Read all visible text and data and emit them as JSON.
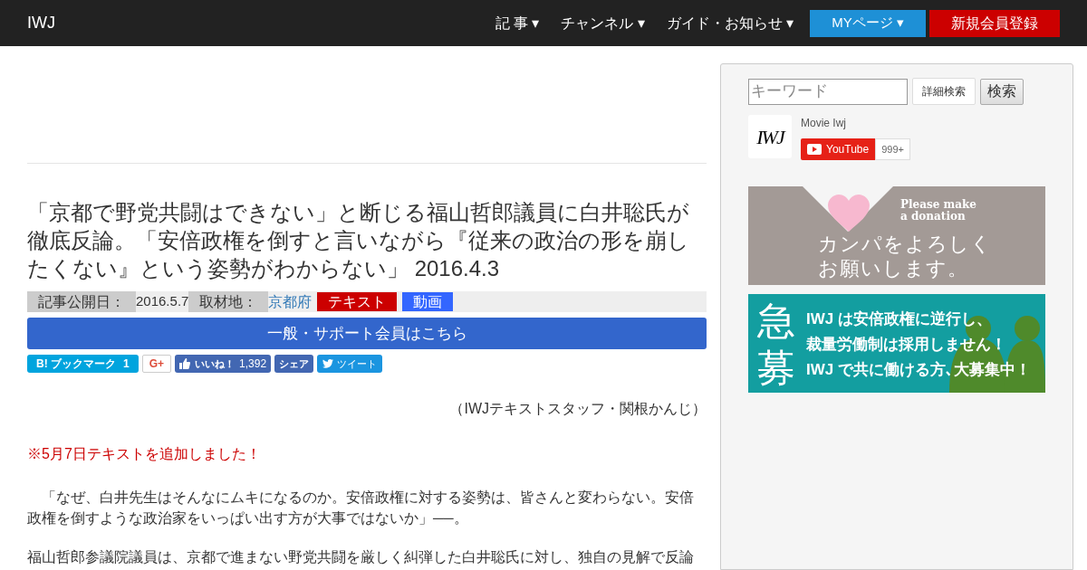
{
  "navbar": {
    "brand": "IWJ",
    "menus": [
      {
        "label": "記 事",
        "kind": "dropdown"
      },
      {
        "label": "チャンネル",
        "kind": "dropdown"
      },
      {
        "label": "ガイド・お知らせ",
        "kind": "dropdown"
      },
      {
        "label": "MYページ",
        "kind": "mypage"
      },
      {
        "label": "新規会員登録",
        "kind": "register"
      }
    ],
    "caret": "▾"
  },
  "article": {
    "title": "「京都で野党共闘はできない」と断じる福山哲郎議員に白井聡氏が徹底反論。「安倍政権を倒すと言いながら『従来の政治の形を崩したくない』という姿勢がわからない」 2016.4.3",
    "meta": {
      "published_label": "記事公開日：",
      "published": "2016.5.7",
      "location_label": "取材地：",
      "location": "京都府",
      "tags": [
        {
          "label": "テキスト",
          "color": "#cc0000"
        },
        {
          "label": "動画",
          "color": "#3366ff"
        }
      ]
    },
    "member_button": "一般・サポート会員はこちら",
    "share": [
      {
        "kind": "hatena",
        "label": "B! ブックマーク",
        "count": "1"
      },
      {
        "kind": "gplus",
        "label": "G+"
      },
      {
        "kind": "like",
        "label": "いいね！",
        "count": "1,392"
      },
      {
        "kind": "share",
        "label": "シェア"
      },
      {
        "kind": "tweet",
        "label": "ツイート"
      }
    ],
    "credit": "（IWJテキストスタッフ・関根かんじ）",
    "notice": "※5月7日テキストを追加しました！",
    "paragraphs": [
      "「なぜ、白井先生はそんなにムキになるのか。安倍政権に対する姿勢は、皆さんと変わらない。安倍政権を倒すような政治家をいっぱい出す方が大事ではないか」──。",
      "福山哲郎参議院議員は、京都で進まない野党共闘を厳しく糾弾した白井聡氏に対し、独自の見解で反論"
    ]
  },
  "sidebar": {
    "search": {
      "placeholder": "キーワード",
      "advanced": "詳細検索",
      "submit": "検索"
    },
    "channel": {
      "name": "Movie Iwj",
      "logo": "IWJ",
      "button": "YouTube",
      "count": "999+"
    },
    "donation_banner": {
      "english": [
        "Please make",
        "a donation"
      ],
      "japanese": [
        "カンパをよろしく",
        "お願いします。"
      ]
    },
    "recruit_banner": {
      "big": [
        "急",
        "募"
      ],
      "lines": [
        "IWJ は安倍政権に逆行し、",
        "裁量労働制は採用しません！",
        "IWJ で共に働ける方､大募集中！"
      ]
    }
  }
}
